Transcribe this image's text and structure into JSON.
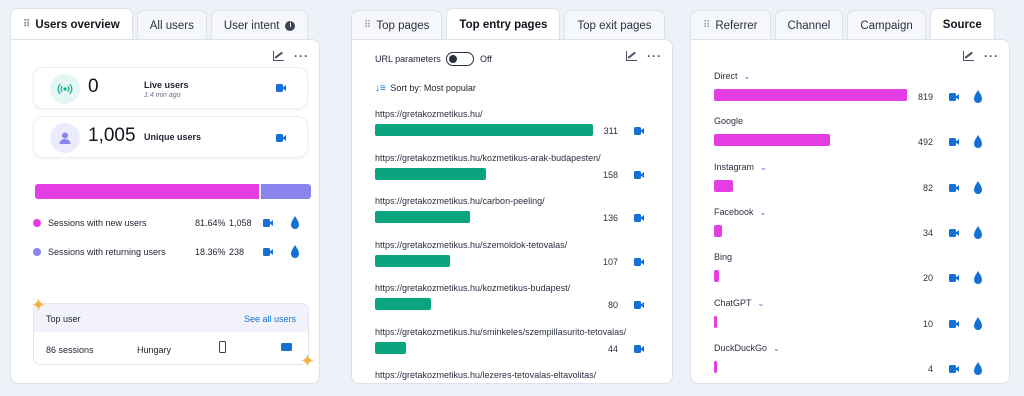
{
  "colors": {
    "magenta": "#e33de3",
    "purple": "#8a85ee",
    "green": "#0aa57f",
    "blue": "#1570d6"
  },
  "panel1": {
    "tabs": [
      "Users overview",
      "All users",
      "User intent"
    ],
    "live": {
      "value": "0",
      "label": "Live users",
      "sub": "1.4 min ago"
    },
    "unique": {
      "value": "1,005",
      "label": "Unique users"
    },
    "split": {
      "new_fraction": 0.8164
    },
    "new_row": {
      "label": "Sessions with new users",
      "pct": "81.64%",
      "count": "1,058"
    },
    "returning_row": {
      "label": "Sessions with returning users",
      "pct": "18.36%",
      "count": "238"
    },
    "top_user": {
      "title": "Top user",
      "link": "See all users",
      "sessions": "86 sessions",
      "country": "Hungary"
    }
  },
  "panel2": {
    "tabs": [
      "Top pages",
      "Top entry pages",
      "Top exit pages"
    ],
    "toggle_label": "URL parameters",
    "toggle_state": "Off",
    "sort_label": "Sort by: Most popular",
    "rows": [
      {
        "url": "https://gretakozmetikus.hu/",
        "value": "311"
      },
      {
        "url": "https://gretakozmetikus.hu/kozmetikus-arak-budapesten/",
        "value": "158"
      },
      {
        "url": "https://gretakozmetikus.hu/carbon-peeling/",
        "value": "136"
      },
      {
        "url": "https://gretakozmetikus.hu/szemoldok-tetovalas/",
        "value": "107"
      },
      {
        "url": "https://gretakozmetikus.hu/kozmetikus-budapest/",
        "value": "80"
      },
      {
        "url": "https://gretakozmetikus.hu/sminkeles/szempillasurito-tetovalas/",
        "value": "44"
      },
      {
        "url": "https://gretakozmetikus.hu/lezeres-tetovalas-eltavolitas/",
        "value": ""
      }
    ]
  },
  "panel3": {
    "tabs": [
      "Referrer",
      "Channel",
      "Campaign",
      "Source"
    ],
    "rows": [
      {
        "label": "Direct",
        "value": "819",
        "chevron": true
      },
      {
        "label": "Google",
        "value": "492",
        "chevron": false
      },
      {
        "label": "Instagram",
        "value": "82",
        "chevron": true
      },
      {
        "label": "Facebook",
        "value": "34",
        "chevron": true
      },
      {
        "label": "Bing",
        "value": "20",
        "chevron": false
      },
      {
        "label": "ChatGPT",
        "value": "10",
        "chevron": true
      },
      {
        "label": "DuckDuckGo",
        "value": "4",
        "chevron": true
      }
    ]
  }
}
